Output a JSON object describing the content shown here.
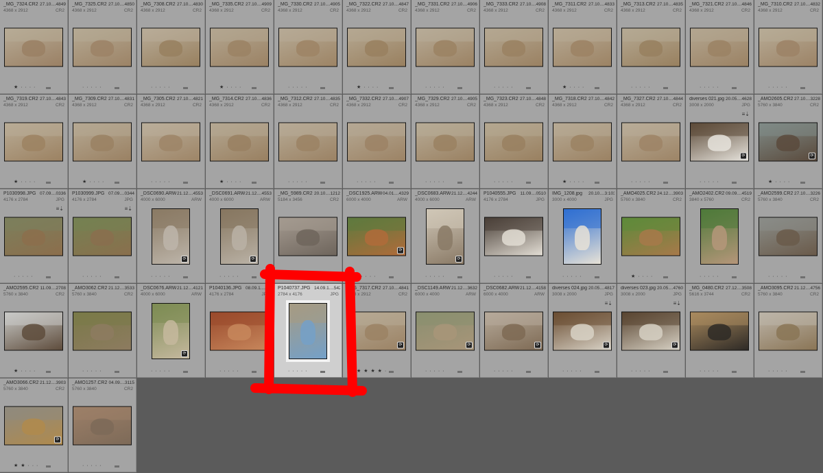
{
  "annotation_color": "#ff0000",
  "cells": [
    {
      "filename": "_MG_7324.CR2",
      "date": "27.10....4849",
      "dims": "4368 x 2912",
      "ext": "CR2",
      "rating": "★ · · · ·",
      "selected": false,
      "orientation": "landscape",
      "palette": [
        "#b7ab96",
        "#9a8064"
      ],
      "badge": false,
      "metadata_icon": ""
    },
    {
      "filename": "_MG_7325.CR2",
      "date": "27.10....4850",
      "dims": "4368 x 2912",
      "ext": "CR2",
      "rating": "· · · · ·",
      "selected": false,
      "orientation": "landscape",
      "palette": [
        "#b5a993",
        "#9c8366"
      ],
      "badge": false,
      "metadata_icon": ""
    },
    {
      "filename": "_MG_7308.CR2",
      "date": "27.10....4830",
      "dims": "4368 x 2912",
      "ext": "CR2",
      "rating": "· · · · ·",
      "selected": false,
      "orientation": "landscape",
      "palette": [
        "#b8ac98",
        "#98805f"
      ],
      "badge": false,
      "metadata_icon": ""
    },
    {
      "filename": "_MG_7335.CR2",
      "date": "27.10....4909",
      "dims": "4368 x 2912",
      "ext": "CR2",
      "rating": "★ · · · ·",
      "selected": false,
      "orientation": "landscape",
      "palette": [
        "#b3a690",
        "#9b8264"
      ],
      "badge": false,
      "metadata_icon": ""
    },
    {
      "filename": "_MG_7330.CR2",
      "date": "27.10....4905",
      "dims": "4368 x 2912",
      "ext": "CR2",
      "rating": "· · · · ·",
      "selected": false,
      "orientation": "landscape",
      "palette": [
        "#b6aa95",
        "#9d8465"
      ],
      "badge": false,
      "metadata_icon": ""
    },
    {
      "filename": "_MG_7322.CR2",
      "date": "27.10....4847",
      "dims": "4368 x 2912",
      "ext": "CR2",
      "rating": "★ · · · ·",
      "selected": false,
      "orientation": "landscape",
      "palette": [
        "#b5a892",
        "#99805f"
      ],
      "badge": false,
      "metadata_icon": ""
    },
    {
      "filename": "_MG_7331.CR2",
      "date": "27.10....4906",
      "dims": "4368 x 2912",
      "ext": "CR2",
      "rating": "· · · · ·",
      "selected": false,
      "orientation": "landscape",
      "palette": [
        "#b7ab97",
        "#9b8263"
      ],
      "badge": false,
      "metadata_icon": ""
    },
    {
      "filename": "_MG_7333.CR2",
      "date": "27.10....4908",
      "dims": "4368 x 2912",
      "ext": "CR2",
      "rating": "· · · · ·",
      "selected": false,
      "orientation": "landscape",
      "palette": [
        "#b4a791",
        "#9a8162"
      ],
      "badge": false,
      "metadata_icon": ""
    },
    {
      "filename": "_MG_7311.CR2",
      "date": "27.10....4833",
      "dims": "4368 x 2912",
      "ext": "CR2",
      "rating": "★ · · · ·",
      "selected": false,
      "orientation": "landscape",
      "palette": [
        "#b6a994",
        "#9c8364"
      ],
      "badge": false,
      "metadata_icon": ""
    },
    {
      "filename": "_MG_7313.CR2",
      "date": "27.10....4835",
      "dims": "4368 x 2912",
      "ext": "CR2",
      "rating": "· · · · ·",
      "selected": false,
      "orientation": "landscape",
      "palette": [
        "#b5a993",
        "#98805f"
      ],
      "badge": false,
      "metadata_icon": ""
    },
    {
      "filename": "_MG_7321.CR2",
      "date": "27.10....4846",
      "dims": "4368 x 2912",
      "ext": "CR2",
      "rating": "· · · · ·",
      "selected": false,
      "orientation": "landscape",
      "palette": [
        "#b3a690",
        "#9b8264"
      ],
      "badge": false,
      "metadata_icon": ""
    },
    {
      "filename": "_MG_7310.CR2",
      "date": "27.10....4832",
      "dims": "4368 x 2912",
      "ext": "CR2",
      "rating": "· · · · ·",
      "selected": false,
      "orientation": "landscape",
      "palette": [
        "#b7ab96",
        "#9c8366"
      ],
      "badge": false,
      "metadata_icon": ""
    },
    {
      "filename": "_MG_7319.CR2",
      "date": "27.10....4843",
      "dims": "4368 x 2912",
      "ext": "CR2",
      "rating": "★ · · · ·",
      "selected": false,
      "orientation": "landscape",
      "palette": [
        "#b8ab95",
        "#9c8262"
      ],
      "badge": false,
      "metadata_icon": ""
    },
    {
      "filename": "_MG_7309.CR2",
      "date": "27.10....4831",
      "dims": "4368 x 2912",
      "ext": "CR2",
      "rating": "★ · · · ·",
      "selected": false,
      "orientation": "landscape",
      "palette": [
        "#b5a892",
        "#9a8163"
      ],
      "badge": false,
      "metadata_icon": ""
    },
    {
      "filename": "_MG_7305.CR2",
      "date": "27.10....4821",
      "dims": "4368 x 2912",
      "ext": "CR2",
      "rating": "· · · · ·",
      "selected": false,
      "orientation": "landscape",
      "palette": [
        "#b9ad99",
        "#9e8567"
      ],
      "badge": false,
      "metadata_icon": ""
    },
    {
      "filename": "_MG_7314.CR2",
      "date": "27.10....4836",
      "dims": "4368 x 2912",
      "ext": "CR2",
      "rating": "★ · · · ·",
      "selected": false,
      "orientation": "landscape",
      "palette": [
        "#b4a791",
        "#998061"
      ],
      "badge": false,
      "metadata_icon": ""
    },
    {
      "filename": "_MG_7312.CR2",
      "date": "27.10....4835",
      "dims": "4368 x 2912",
      "ext": "CR2",
      "rating": "· · · · ·",
      "selected": false,
      "orientation": "landscape",
      "palette": [
        "#b6aa95",
        "#9b8264"
      ],
      "badge": false,
      "metadata_icon": ""
    },
    {
      "filename": "_MG_7332.CR2",
      "date": "27.10....4907",
      "dims": "4368 x 2912",
      "ext": "CR2",
      "rating": "· · · · ·",
      "selected": false,
      "orientation": "landscape",
      "palette": [
        "#b5a893",
        "#9c8365"
      ],
      "badge": false,
      "metadata_icon": ""
    },
    {
      "filename": "_MG_7329.CR2",
      "date": "27.10....4905",
      "dims": "4368 x 2912",
      "ext": "CR2",
      "rating": "· · · · ·",
      "selected": false,
      "orientation": "landscape",
      "palette": [
        "#b7ab96",
        "#9a8162"
      ],
      "badge": false,
      "metadata_icon": ""
    },
    {
      "filename": "_MG_7323.CR2",
      "date": "27.10....4848",
      "dims": "4368 x 2912",
      "ext": "CR2",
      "rating": "· · · · ·",
      "selected": false,
      "orientation": "landscape",
      "palette": [
        "#b4a790",
        "#998060"
      ],
      "badge": false,
      "metadata_icon": ""
    },
    {
      "filename": "_MG_7318.CR2",
      "date": "27.10....4842",
      "dims": "4368 x 2912",
      "ext": "CR2",
      "rating": "★ · · · ·",
      "selected": false,
      "orientation": "landscape",
      "palette": [
        "#b6a994",
        "#9b8263"
      ],
      "badge": false,
      "metadata_icon": ""
    },
    {
      "filename": "_MG_7327.CR2",
      "date": "27.10....4844",
      "dims": "4368 x 2912",
      "ext": "CR2",
      "rating": "· · · · ·",
      "selected": false,
      "orientation": "landscape",
      "palette": [
        "#b8ac97",
        "#9d8466"
      ],
      "badge": false,
      "metadata_icon": ""
    },
    {
      "filename": "diverses 021.jpg",
      "date": "20.05....4628",
      "dims": "3008 x 2000",
      "ext": "JPG",
      "rating": "· · · · ·",
      "selected": false,
      "orientation": "landscape",
      "palette": [
        "#5c4a38",
        "#e6e3dc"
      ],
      "badge": true,
      "metadata_icon": "≡⇣"
    },
    {
      "filename": "_AMO2605.CR2",
      "date": "27.10....3228",
      "dims": "5760 x 3840",
      "ext": "CR2",
      "rating": "★ · · · ·",
      "selected": false,
      "orientation": "landscape",
      "palette": [
        "#7f8a86",
        "#5a4a3c"
      ],
      "badge": true,
      "metadata_icon": ""
    },
    {
      "filename": "P1030998.JPG",
      "date": "07.09....0336",
      "dims": "4176 x 2784",
      "ext": "JPG",
      "rating": "· · · · ·",
      "selected": false,
      "orientation": "landscape",
      "palette": [
        "#7c7f5c",
        "#8c6e4c"
      ],
      "badge": false,
      "metadata_icon": "≡⇣"
    },
    {
      "filename": "P1030999.JPG",
      "date": "07.09....0344",
      "dims": "4176 x 2784",
      "ext": "JPG",
      "rating": "· · · · ·",
      "selected": false,
      "orientation": "landscape",
      "palette": [
        "#758152",
        "#8a6f4d"
      ],
      "badge": false,
      "metadata_icon": "≡⇣"
    },
    {
      "filename": "_DSC0690.ARW",
      "date": "21.12....4553",
      "dims": "4000 x 6000",
      "ext": "ARW",
      "rating": "· · · · ·",
      "selected": false,
      "orientation": "portrait",
      "palette": [
        "#8a7a64",
        "#bdb5aa"
      ],
      "badge": true,
      "metadata_icon": ""
    },
    {
      "filename": "_DSC0691.ARW",
      "date": "21.12....4553",
      "dims": "4000 x 6000",
      "ext": "ARW",
      "rating": "· · · · ·",
      "selected": false,
      "orientation": "portrait",
      "palette": [
        "#877760",
        "#bab2a6"
      ],
      "badge": true,
      "metadata_icon": ""
    },
    {
      "filename": "_MG_5989.CR2",
      "date": "20.10....1212",
      "dims": "5184 x 3456",
      "ext": "CR2",
      "rating": "· · · · ·",
      "selected": false,
      "orientation": "landscape",
      "palette": [
        "#a49a90",
        "#6e655c"
      ],
      "badge": false,
      "metadata_icon": ""
    },
    {
      "filename": "_DSC1925.ARW",
      "date": "04.01....4329",
      "dims": "6000 x 4000",
      "ext": "ARW",
      "rating": "· · · · ·",
      "selected": false,
      "orientation": "landscape",
      "palette": [
        "#5e7a3e",
        "#b06b3a"
      ],
      "badge": true,
      "metadata_icon": ""
    },
    {
      "filename": "_DSC0683.ARW",
      "date": "21.12....4244",
      "dims": "4000 x 6000",
      "ext": "ARW",
      "rating": "· · · · ·",
      "selected": false,
      "orientation": "portrait",
      "palette": [
        "#cfc6b7",
        "#8a7a66"
      ],
      "badge": true,
      "metadata_icon": ""
    },
    {
      "filename": "P1040555.JPG",
      "date": "11.09....0510",
      "dims": "4176 x 2784",
      "ext": "JPG",
      "rating": "· · · · ·",
      "selected": false,
      "orientation": "landscape",
      "palette": [
        "#4a4038",
        "#e2ddd4"
      ],
      "badge": false,
      "metadata_icon": ""
    },
    {
      "filename": "IMG_1208.jpg",
      "date": "20.10....3:1035",
      "dims": "3000 x 4000",
      "ext": "JPG",
      "rating": "· · · · ·",
      "selected": false,
      "orientation": "portrait",
      "palette": [
        "#2f6fd1",
        "#e8e2d6"
      ],
      "badge": false,
      "metadata_icon": ""
    },
    {
      "filename": "_AMO4025.CR2",
      "date": "24.12....3903",
      "dims": "5760 x 3840",
      "ext": "CR2",
      "rating": "★ · · · ·",
      "selected": false,
      "orientation": "landscape",
      "palette": [
        "#5e8a3a",
        "#a7794a"
      ],
      "badge": false,
      "metadata_icon": ""
    },
    {
      "filename": "_AMO2402.CR2",
      "date": "09.09....4519",
      "dims": "3840 x 5760",
      "ext": "CR2",
      "rating": "· · · · ·",
      "selected": false,
      "orientation": "portrait",
      "palette": [
        "#4f7a3a",
        "#b5967a"
      ],
      "badge": false,
      "metadata_icon": ""
    },
    {
      "filename": "_AMO2599.CR2",
      "date": "27.10....3226",
      "dims": "5760 x 3840",
      "ext": "CR2",
      "rating": "· · · · ·",
      "selected": false,
      "orientation": "landscape",
      "palette": [
        "#8a8d88",
        "#6a5a4a"
      ],
      "badge": false,
      "metadata_icon": ""
    },
    {
      "filename": "_AMO2595.CR2",
      "date": "11.09....2708",
      "dims": "5760 x 3840",
      "ext": "CR2",
      "rating": "★ · · · ·",
      "selected": false,
      "orientation": "landscape",
      "palette": [
        "#c8c9c6",
        "#5e4c3c"
      ],
      "badge": false,
      "metadata_icon": ""
    },
    {
      "filename": "_AMO3062.CR2",
      "date": "21.12....3533",
      "dims": "5760 x 3840",
      "ext": "CR2",
      "rating": "· · · · ·",
      "selected": false,
      "orientation": "landscape",
      "palette": [
        "#7a7a48",
        "#8d7b60"
      ],
      "badge": false,
      "metadata_icon": ""
    },
    {
      "filename": "_DSC0676.ARW",
      "date": "21.12....4121",
      "dims": "4000 x 6000",
      "ext": "ARW",
      "rating": "· · · · ·",
      "selected": false,
      "orientation": "portrait",
      "palette": [
        "#7d8c54",
        "#c5b89e"
      ],
      "badge": true,
      "metadata_icon": ""
    },
    {
      "filename": "P1040136.JPG",
      "date": "08.09.1....4115",
      "dims": "4176 x 2784",
      "ext": "JPG",
      "rating": "· · · · ·",
      "selected": false,
      "orientation": "landscape",
      "palette": [
        "#9a4a2c",
        "#c7875c"
      ],
      "badge": false,
      "metadata_icon": ""
    },
    {
      "filename": "P1040737.JPG",
      "date": "14.09.1....5422",
      "dims": "2784 x 4176",
      "ext": "JPG",
      "rating": "· · · · ·",
      "selected": true,
      "orientation": "portrait",
      "palette": [
        "#a59b84",
        "#74a0c8"
      ],
      "badge": false,
      "metadata_icon": ""
    },
    {
      "filename": "_MG_7317.CR2",
      "date": "27.10....4841",
      "dims": "4368 x 2912",
      "ext": "CR2",
      "rating": "★ ★ ★ ★ ·",
      "selected": false,
      "orientation": "landscape",
      "palette": [
        "#b6a994",
        "#9b8264"
      ],
      "badge": true,
      "metadata_icon": ""
    },
    {
      "filename": "_DSC1149.ARW",
      "date": "21.12....3632",
      "dims": "6000 x 4000",
      "ext": "ARW",
      "rating": "· · · · ·",
      "selected": false,
      "orientation": "landscape",
      "palette": [
        "#8b8f70",
        "#a89579"
      ],
      "badge": true,
      "metadata_icon": ""
    },
    {
      "filename": "_DSC0682.ARW",
      "date": "21.12....4158",
      "dims": "6000 x 4000",
      "ext": "ARW",
      "rating": "· · · · ·",
      "selected": false,
      "orientation": "landscape",
      "palette": [
        "#b6aa9a",
        "#7e6a54"
      ],
      "badge": true,
      "metadata_icon": ""
    },
    {
      "filename": "diverses 024.jpg",
      "date": "20.05....4817",
      "dims": "3008 x 2000",
      "ext": "JPG",
      "rating": "· · · · ·",
      "selected": false,
      "orientation": "landscape",
      "palette": [
        "#6b4e33",
        "#d8d2c6"
      ],
      "badge": true,
      "metadata_icon": "≡⇣"
    },
    {
      "filename": "diverses 023.jpg",
      "date": "20.05....4760",
      "dims": "3008 x 2000",
      "ext": "JPG",
      "rating": "· · · · ·",
      "selected": false,
      "orientation": "landscape",
      "palette": [
        "#5a4632",
        "#d6d0c3"
      ],
      "badge": true,
      "metadata_icon": "≡⇣"
    },
    {
      "filename": "_MG_0480.CR2",
      "date": "27.12....3508",
      "dims": "5616 x 3744",
      "ext": "CR2",
      "rating": "· · · · ·",
      "selected": false,
      "orientation": "landscape",
      "palette": [
        "#a98a5e",
        "#2e2a26"
      ],
      "badge": false,
      "metadata_icon": ""
    },
    {
      "filename": "_AMO3095.CR2",
      "date": "21.12....4756",
      "dims": "5760 x 3840",
      "ext": "CR2",
      "rating": "· · · · ·",
      "selected": false,
      "orientation": "landscape",
      "palette": [
        "#bcb4a8",
        "#8a7556"
      ],
      "badge": false,
      "metadata_icon": ""
    },
    {
      "filename": "_AMO3066.CR2",
      "date": "21.12....3903",
      "dims": "5760 x 3840",
      "ext": "CR2",
      "rating": "★ ★ · · ·",
      "selected": false,
      "orientation": "landscape",
      "palette": [
        "#8f8a7e",
        "#b08a4c"
      ],
      "badge": true,
      "metadata_icon": ""
    },
    {
      "filename": "_AMO1257.CR2",
      "date": "04.09....3115",
      "dims": "5760 x 3840",
      "ext": "CR2",
      "rating": "· · · · ·",
      "selected": false,
      "orientation": "landscape",
      "palette": [
        "#9c7f68",
        "#7d6a58"
      ],
      "badge": false,
      "metadata_icon": ""
    }
  ]
}
